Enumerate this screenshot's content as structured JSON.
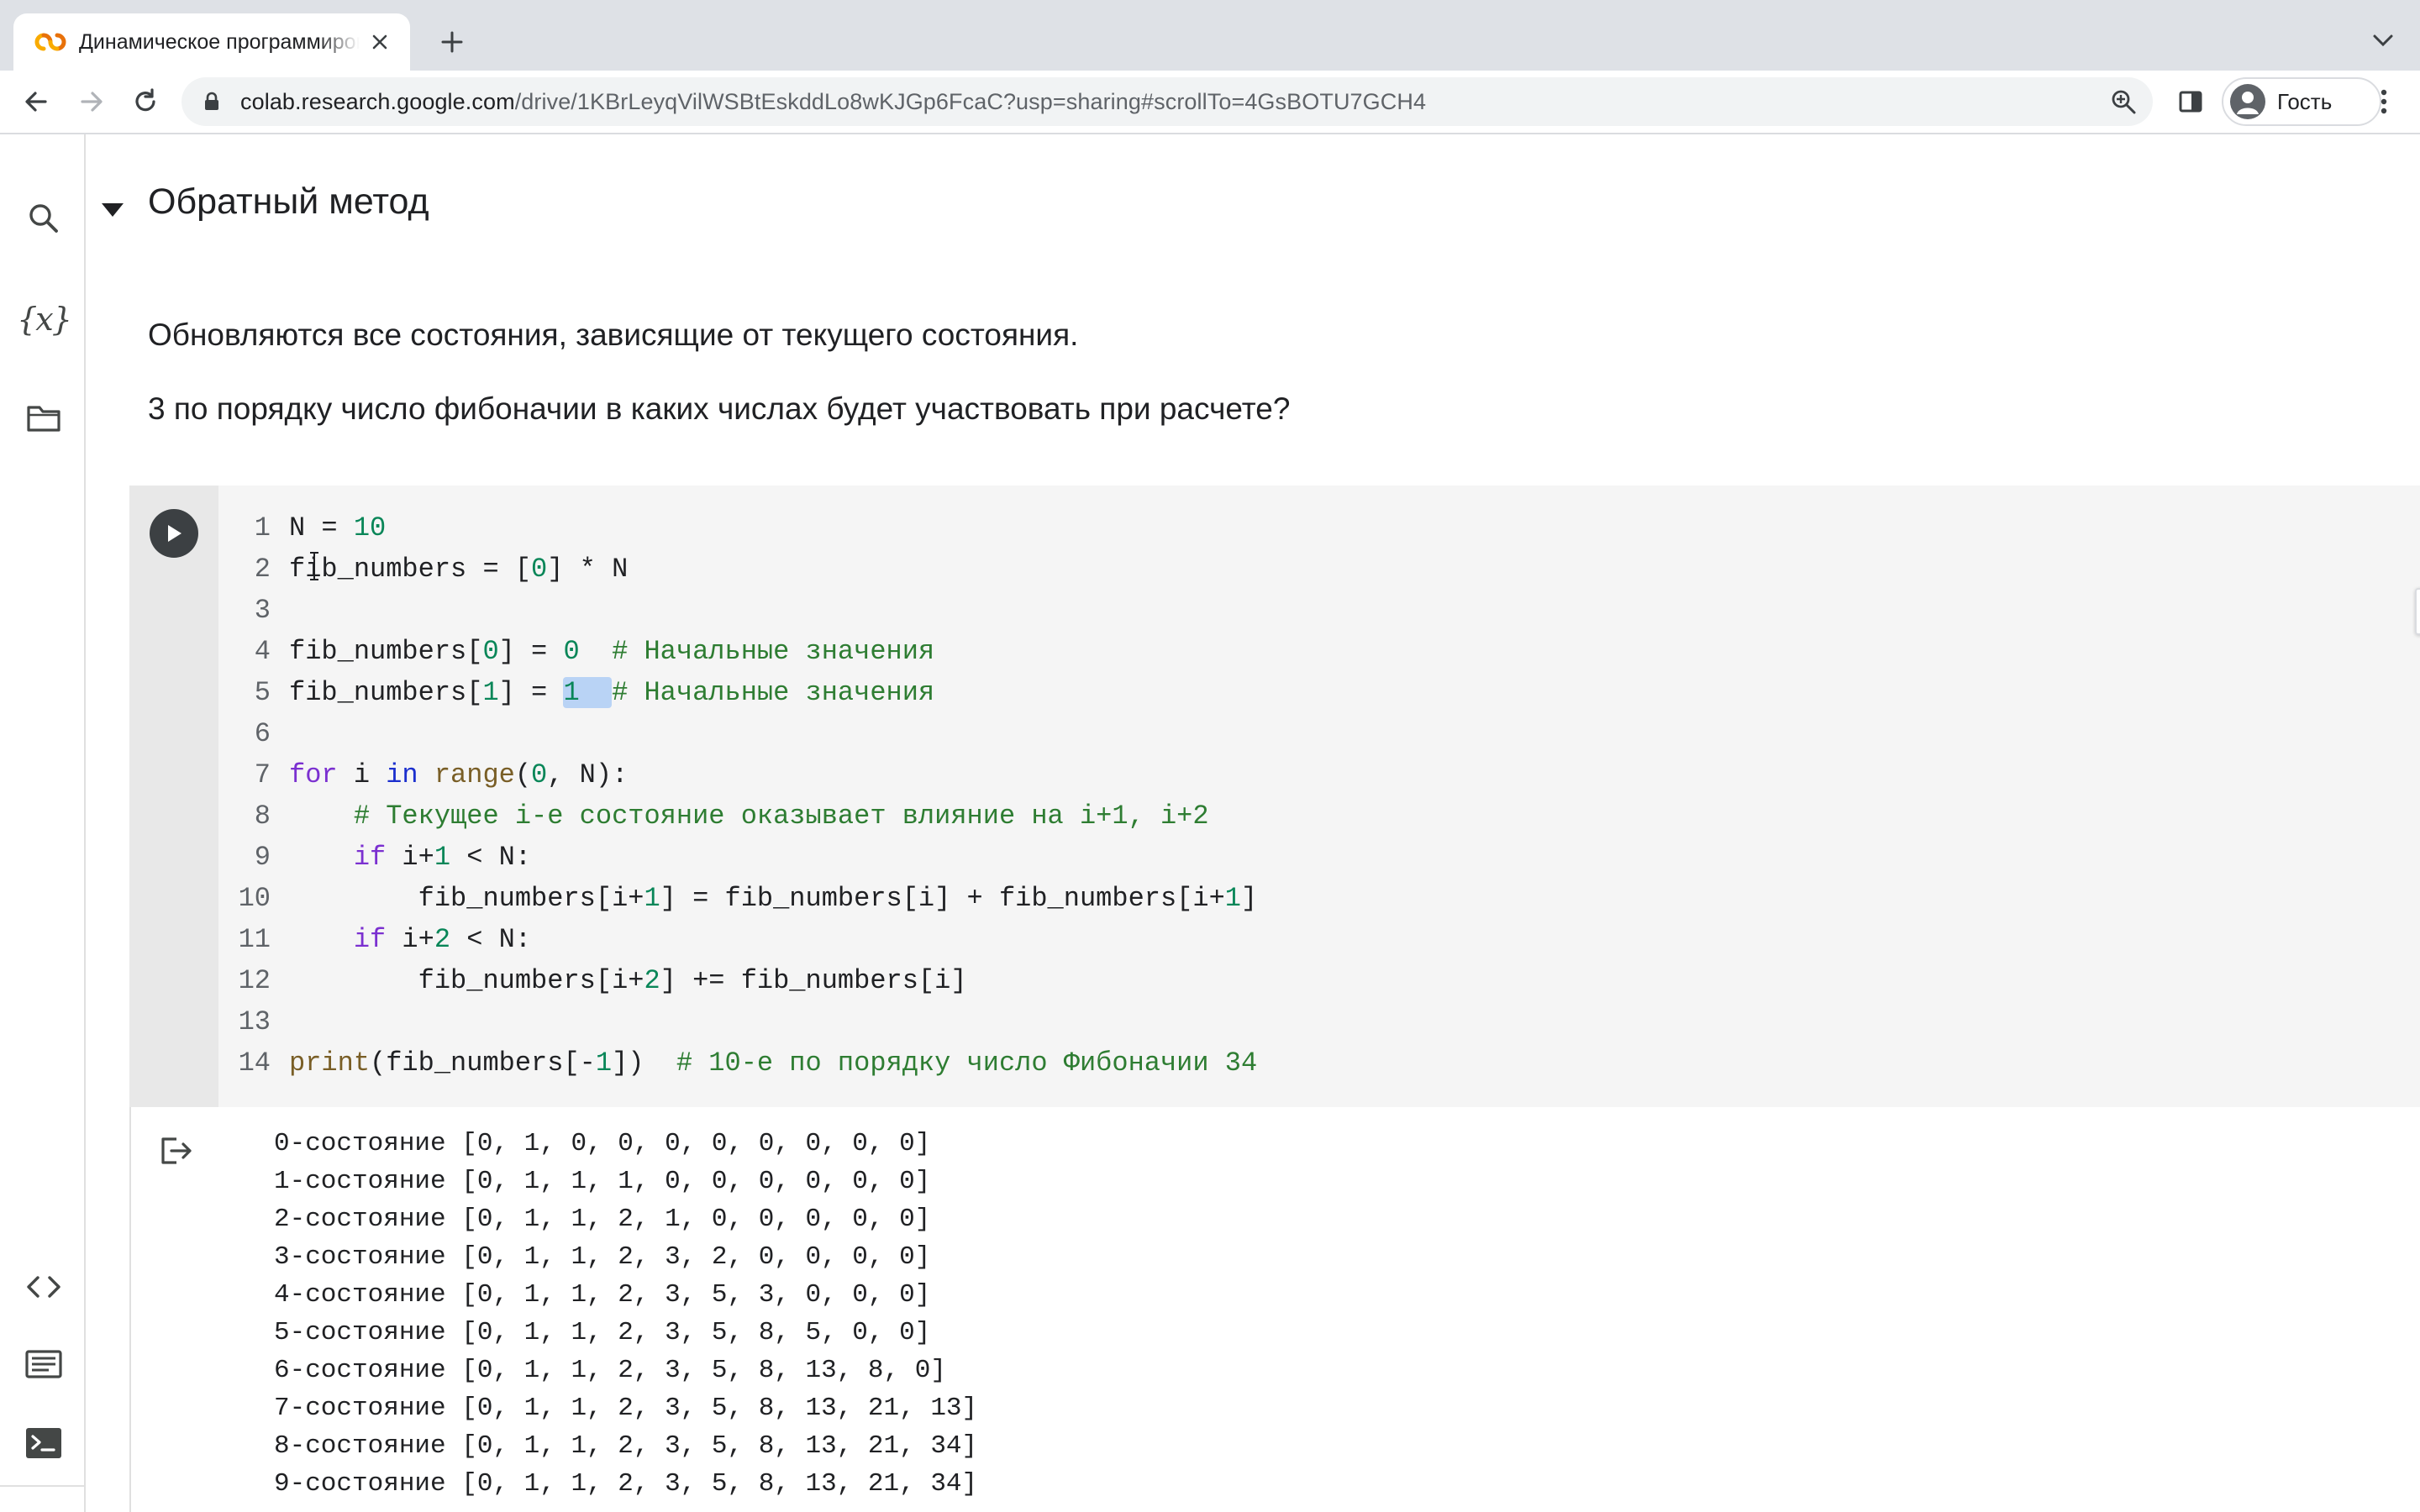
{
  "browser": {
    "tab_title": "Динамическое программирование",
    "new_tab_label": "+",
    "url_host": "colab.research.google.com",
    "url_path": "/drive/1KBrLeyqVilWSBtEskddLo8wKJGp6FcaC?usp=sharing#scrollTo=4GsBOTU7GCH4",
    "profile_label": "Гость"
  },
  "sidebar": {
    "items": [
      {
        "icon": "search-icon"
      },
      {
        "icon": "variables-icon",
        "glyph": "{x}"
      },
      {
        "icon": "folder-icon"
      },
      {
        "icon": "code-snippets-icon"
      },
      {
        "icon": "command-palette-icon"
      },
      {
        "icon": "terminal-icon"
      }
    ]
  },
  "notebook": {
    "section_title": "Обратный метод",
    "text1": "Обновляются все состояния, зависящие от текущего состояния.",
    "text2": "3 по порядку число фибоначии в каких числах будет участвовать при расчете?",
    "code_lines": [
      {
        "n": "1",
        "code": "N = 10"
      },
      {
        "n": "2",
        "code": "fib_numbers = [0] * N"
      },
      {
        "n": "3",
        "code": ""
      },
      {
        "n": "4",
        "code": "fib_numbers[0] = 0  # Начальные значения"
      },
      {
        "n": "5",
        "code": "fib_numbers[1] = 1  # Начальные значения"
      },
      {
        "n": "6",
        "code": ""
      },
      {
        "n": "7",
        "code": "for i in range(0, N):"
      },
      {
        "n": "8",
        "code": "    # Текущее i-е состояние оказывает влияние на i+1, i+2"
      },
      {
        "n": "9",
        "code": "    if i+1 < N:"
      },
      {
        "n": "10",
        "code": "        fib_numbers[i+1] = fib_numbers[i] + fib_numbers[i+1]"
      },
      {
        "n": "11",
        "code": "    if i+2 < N:"
      },
      {
        "n": "12",
        "code": "        fib_numbers[i+2] += fib_numbers[i]"
      },
      {
        "n": "13",
        "code": ""
      },
      {
        "n": "14",
        "code": "print(fib_numbers[-1])  # 10-е по порядку число Фибоначии 34"
      }
    ],
    "output_lines": [
      "0-состояние [0, 1, 0, 0, 0, 0, 0, 0, 0, 0]",
      "1-состояние [0, 1, 1, 1, 0, 0, 0, 0, 0, 0]",
      "2-состояние [0, 1, 1, 2, 1, 0, 0, 0, 0, 0]",
      "3-состояние [0, 1, 1, 2, 3, 2, 0, 0, 0, 0]",
      "4-состояние [0, 1, 1, 2, 3, 5, 3, 0, 0, 0]",
      "5-состояние [0, 1, 1, 2, 3, 5, 8, 5, 0, 0]",
      "6-состояние [0, 1, 1, 2, 3, 5, 8, 13, 8, 0]",
      "7-состояние [0, 1, 1, 2, 3, 5, 8, 13, 21, 13]",
      "8-состояние [0, 1, 1, 2, 3, 5, 8, 13, 21, 34]",
      "9-состояние [0, 1, 1, 2, 3, 5, 8, 13, 21, 34]"
    ]
  }
}
